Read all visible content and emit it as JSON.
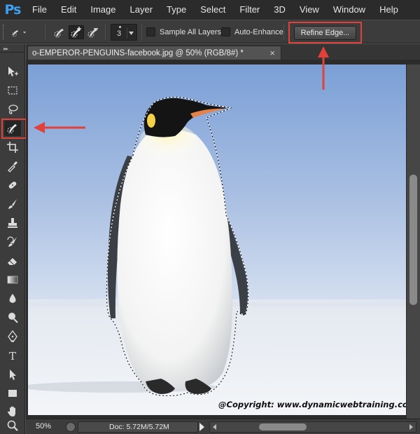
{
  "app": {
    "logo": "Ps",
    "menu": [
      "File",
      "Edit",
      "Image",
      "Layer",
      "Type",
      "Select",
      "Filter",
      "3D",
      "View",
      "Window",
      "Help"
    ]
  },
  "options_bar": {
    "brush_size": "3",
    "sample_all_layers_label": "Sample All Layers",
    "auto_enhance_label": "Auto-Enhance",
    "refine_edge_label": "Refine Edge...",
    "sample_all_layers_checked": false,
    "auto_enhance_checked": false
  },
  "document": {
    "tab_title": "o-EMPEROR-PENGUINS-facebook.jpg @ 50% (RGB/8#) *",
    "copyright": "@Copyright: www.dynamicwebtraining.com.au"
  },
  "status": {
    "zoom": "50%",
    "doc_info": "Doc: 5.72M/5.72M"
  },
  "tools": [
    "move-icon",
    "marquee-icon",
    "lasso-icon",
    "quick-selection-icon",
    "crop-icon",
    "eyedropper-icon",
    "spot-healing-icon",
    "brush-icon",
    "clone-stamp-icon",
    "history-brush-icon",
    "eraser-icon",
    "gradient-icon",
    "blur-icon",
    "dodge-icon",
    "pen-icon",
    "type-icon",
    "path-selection-icon",
    "rectangle-icon",
    "hand-icon",
    "zoom-icon"
  ],
  "colors": {
    "highlight": "#e0413a",
    "ps_blue": "#3ea0f0",
    "sky_top": "#7fa2d6",
    "snow": "#eef1f6"
  }
}
